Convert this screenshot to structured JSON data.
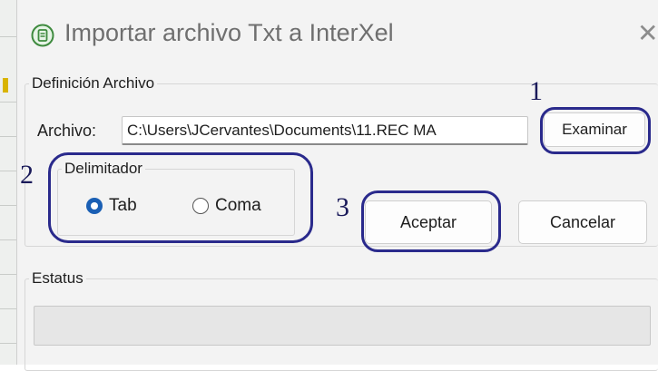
{
  "window": {
    "title": "Importar archivo Txt a InterXel",
    "close_glyph": "✕",
    "icon": "app-icon"
  },
  "definicion": {
    "legend": "Definición Archivo",
    "file_label": "Archivo:",
    "file_value": "C:\\Users\\JCervantes\\Documents\\11.REC MA",
    "browse_label": "Examinar"
  },
  "delimitador": {
    "legend": "Delimitador",
    "options": [
      {
        "label": "Tab",
        "selected": true
      },
      {
        "label": "Coma",
        "selected": false
      }
    ]
  },
  "actions": {
    "accept_label": "Aceptar",
    "cancel_label": "Cancelar"
  },
  "estatus": {
    "legend": "Estatus",
    "progress": 0
  },
  "annotations": {
    "one": "1",
    "two": "2",
    "three": "3"
  },
  "colors": {
    "annotation": "#2a2a8c",
    "radio_selected": "#1a5fb4"
  }
}
